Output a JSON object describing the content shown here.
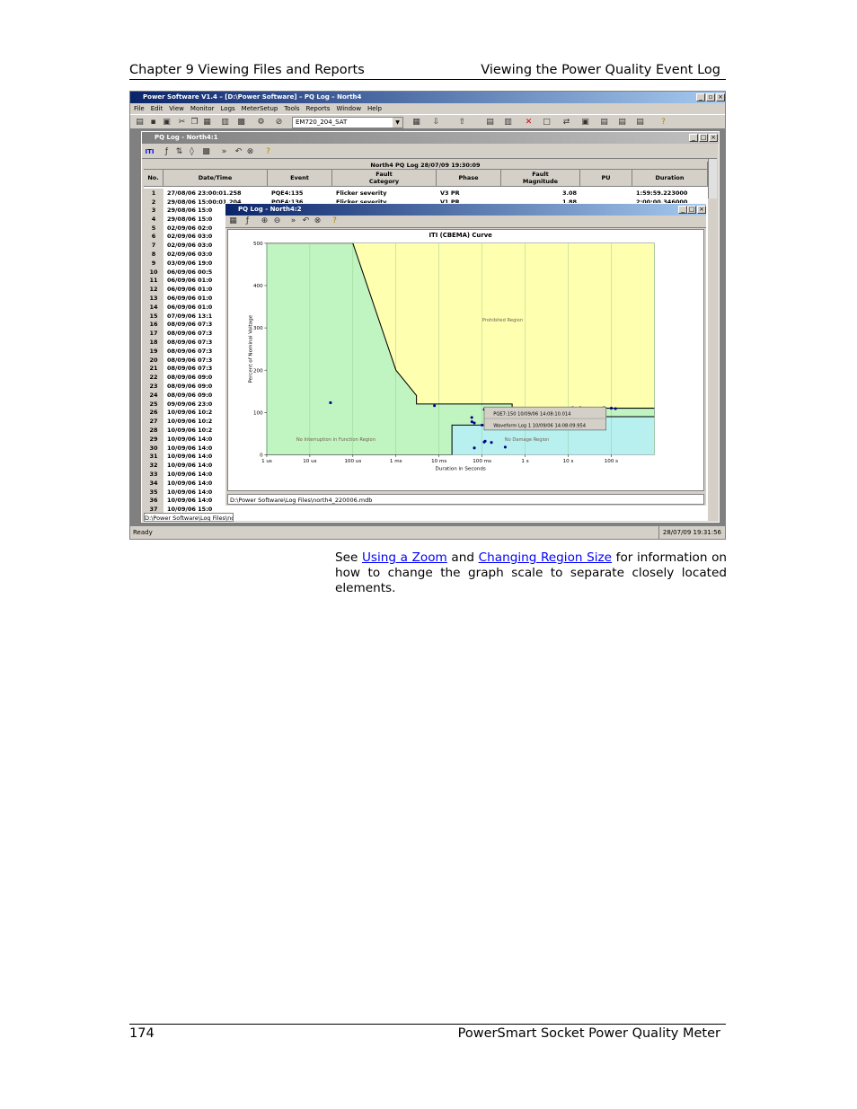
{
  "header": {
    "left": "Chapter 9 Viewing Files and Reports",
    "right": "Viewing the Power Quality Event Log"
  },
  "footer": {
    "page": "174",
    "title": "PowerSmart Socket Power Quality Meter"
  },
  "app": {
    "title": "Power Software V1.4 – [D:\\Power Software] – PQ Log – North4",
    "menu": [
      "File",
      "Edit",
      "View",
      "Monitor",
      "Logs",
      "MeterSetup",
      "Tools",
      "Reports",
      "Window",
      "Help"
    ],
    "device": "EM720_204_SAT",
    "status_left": "Ready",
    "status_right": "28/07/09 19:31:56"
  },
  "pqlog": {
    "title": "PQ Log - North4:1",
    "caption": "North4  PQ Log  28/07/09 19:30:09",
    "columns": [
      "No.",
      "Date/Time",
      "Event",
      "Fault\nCategory",
      "Phase",
      "Fault\nMagnitude",
      "PU",
      "Duration"
    ],
    "rows": [
      [
        "1",
        "27/08/06 23:00:01.258",
        "PQE4:135",
        "Flicker severity",
        "V3 PR",
        "3.08",
        "",
        "1:59:59.223000"
      ],
      [
        "2",
        "29/08/06 15:00:01.204",
        "PQE4:136",
        "Flicker severity",
        "V1 PR",
        "1.88",
        "",
        "2:00:00.346000"
      ]
    ],
    "side_rows": [
      [
        "3",
        "29/08/06 15:0"
      ],
      [
        "4",
        "29/08/06 15:0"
      ],
      [
        "5",
        "02/09/06 02:0"
      ],
      [
        "6",
        "02/09/06 03:0"
      ],
      [
        "7",
        "02/09/06 03:0"
      ],
      [
        "8",
        "02/09/06 03:0"
      ],
      [
        "9",
        "03/09/06 19:0"
      ],
      [
        "10",
        "06/09/06 00:5"
      ],
      [
        "11",
        "06/09/06 01:0"
      ],
      [
        "12",
        "06/09/06 01:0"
      ],
      [
        "13",
        "06/09/06 01:0"
      ],
      [
        "14",
        "06/09/06 01:0"
      ],
      [
        "15",
        "07/09/06 13:1"
      ],
      [
        "16",
        "08/09/06 07:3"
      ],
      [
        "17",
        "08/09/06 07:3"
      ],
      [
        "18",
        "08/09/06 07:3"
      ],
      [
        "19",
        "08/09/06 07:3"
      ],
      [
        "20",
        "08/09/06 07:3"
      ],
      [
        "21",
        "08/09/06 07:3"
      ],
      [
        "22",
        "08/09/06 09:0"
      ],
      [
        "23",
        "08/09/06 09:0"
      ],
      [
        "24",
        "08/09/06 09:0"
      ],
      [
        "25",
        "09/09/06 23:0"
      ],
      [
        "26",
        "10/09/06 10:2"
      ],
      [
        "27",
        "10/09/06 10:2"
      ],
      [
        "28",
        "10/09/06 10:2"
      ],
      [
        "29",
        "10/09/06 14:0"
      ],
      [
        "30",
        "10/09/06 14:0"
      ],
      [
        "31",
        "10/09/06 14:0"
      ],
      [
        "32",
        "10/09/06 14:0"
      ],
      [
        "33",
        "10/09/06 14:0"
      ],
      [
        "34",
        "10/09/06 14:0"
      ],
      [
        "35",
        "10/09/06 14:0"
      ],
      [
        "36",
        "10/09/06 14:0"
      ],
      [
        "37",
        "10/09/06 15:0"
      ]
    ],
    "path_short": "D:\\Power Software\\Log Files\\north"
  },
  "iti": {
    "title": "PQ Log - North4:2",
    "path": "D:\\Power Software\\Log Files\\north4_220006.mdb",
    "popup": [
      "PQE7:150  10/09/06  14:08:10.014",
      "Waveform Log 1  10/09/06  14:08:09.954"
    ]
  },
  "chart_data": {
    "type": "scatter",
    "title": "ITI (CBEMA) Curve",
    "xlabel": "Duration in Seconds",
    "ylabel": "Percent of Nominal Voltage",
    "xscale": "log",
    "xlim": [
      1e-06,
      1000
    ],
    "ylim": [
      0,
      500
    ],
    "xticks": [
      "1 us",
      "10 us",
      "100 us",
      "1 ms",
      "10 ms",
      "100 ms",
      "1 s",
      "10 s",
      "100 s"
    ],
    "yticks": [
      0,
      100,
      200,
      300,
      400,
      500
    ],
    "regions": [
      "Prohibited Region",
      "No Interruption in Function Region",
      "No Damage Region"
    ],
    "upper_curve": [
      [
        0.0001,
        500
      ],
      [
        0.001,
        200
      ],
      [
        0.003,
        140
      ],
      [
        0.003,
        120
      ],
      [
        0.5,
        120
      ],
      [
        0.5,
        110
      ],
      [
        1000,
        110
      ]
    ],
    "lower_curve": [
      [
        0.02,
        0
      ],
      [
        0.02,
        70
      ],
      [
        0.5,
        70
      ],
      [
        0.5,
        80
      ],
      [
        10,
        80
      ],
      [
        10,
        90
      ],
      [
        1000,
        90
      ]
    ],
    "points": [
      [
        3.02e-05,
        123
      ],
      [
        0.00785,
        116
      ],
      [
        0.0577,
        88
      ],
      [
        0.0582,
        78
      ],
      [
        0.066,
        75
      ],
      [
        0.1,
        70
      ],
      [
        0.112,
        30
      ],
      [
        0.118,
        32
      ],
      [
        0.165,
        29
      ],
      [
        0.113,
        107
      ],
      [
        0.345,
        18
      ],
      [
        0.0662,
        16
      ],
      [
        12.7,
        111
      ],
      [
        19.1,
        111
      ],
      [
        23.5,
        110
      ],
      [
        38.7,
        108
      ],
      [
        60.0,
        110
      ],
      [
        67.8,
        111
      ],
      [
        100.3,
        110
      ],
      [
        125.5,
        109
      ]
    ],
    "colors": {
      "prohibited": "#ffffb0",
      "no_interruption": "#c0f4c0",
      "no_damage": "#b8f0f0",
      "points": "#00008b"
    }
  },
  "body_text": {
    "pre": "See ",
    "link1": "Using a Zoom",
    "mid": " and ",
    "link2": "Changing Region Size",
    "post": " for information on how to change the graph scale to separate  closely located elements."
  }
}
